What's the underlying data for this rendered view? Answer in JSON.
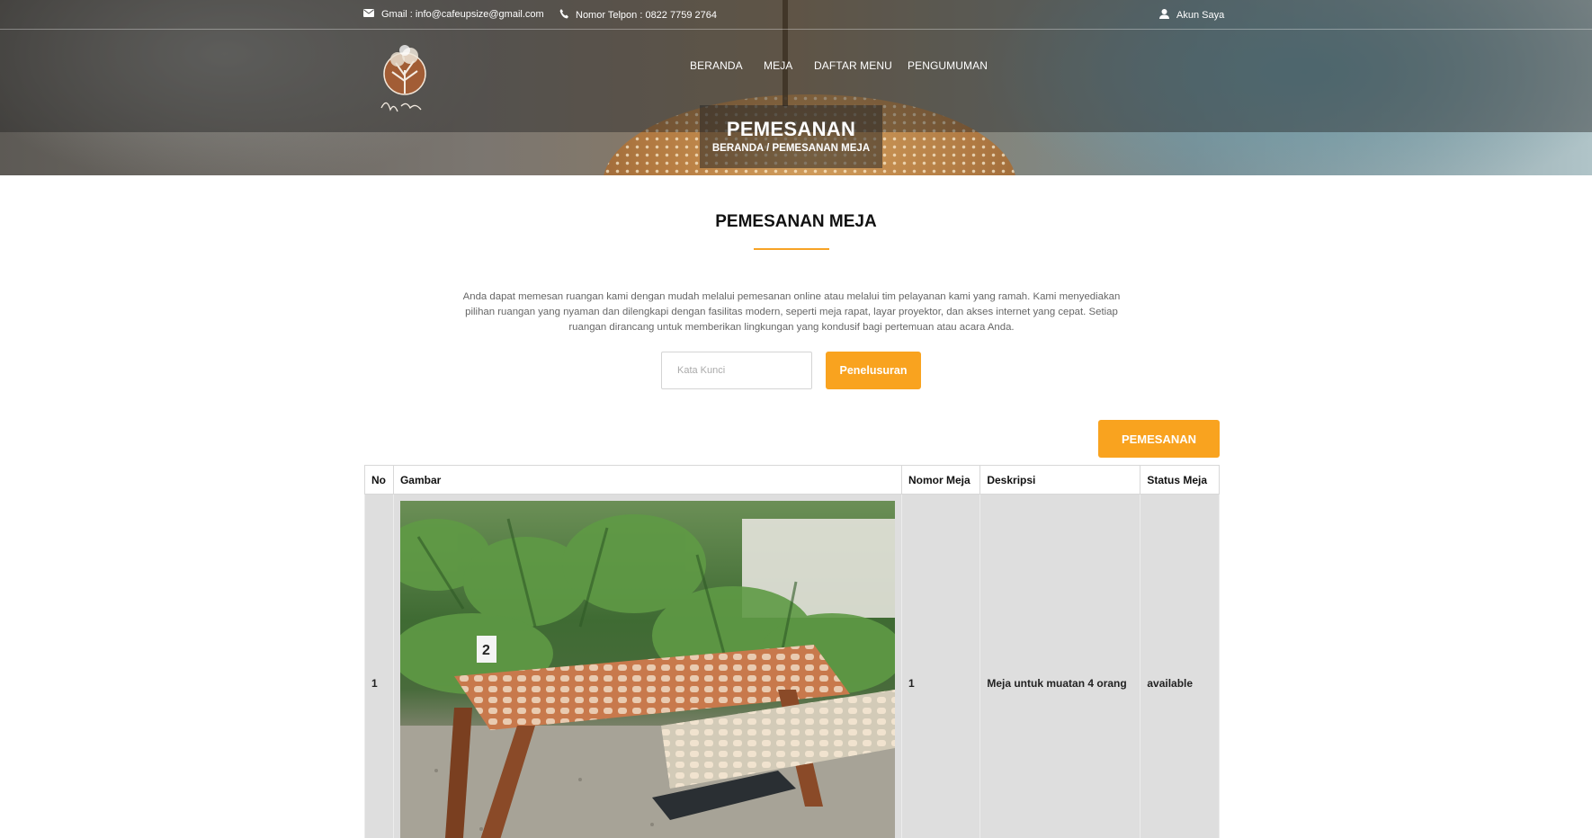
{
  "topbar": {
    "email": "Gmail : info@cafeupsize@gmail.com",
    "phone": "Nomor Telpon : 0822 7759 2764",
    "account": "Akun Saya"
  },
  "nav": {
    "items": [
      "BERANDA",
      "MEJA",
      "DAFTAR MENU",
      "PENGUMUMAN"
    ]
  },
  "banner": {
    "title": "PEMESANAN",
    "breadcrumb": "BERANDA  /  PEMESANAN MEJA"
  },
  "main": {
    "title": "PEMESANAN MEJA",
    "intro": "Anda dapat memesan ruangan kami dengan mudah melalui pemesanan online atau melalui tim pelayanan kami yang ramah. Kami menyediakan pilihan ruangan yang nyaman dan dilengkapi dengan fasilitas modern, seperti meja rapat, layar proyektor, dan akses internet yang cepat. Setiap ruangan dirancang untuk memberikan lingkungan yang kondusif bagi pertemuan atau acara Anda.",
    "search_placeholder": "Kata Kunci",
    "search_button": "Penelusuran",
    "order_button": "PEMESANAN"
  },
  "table": {
    "headers": [
      "No",
      "Gambar",
      "Nomor Meja",
      "Deskripsi",
      "Status Meja"
    ],
    "rows": [
      {
        "no": "1",
        "nomor_meja": "1",
        "deskripsi": "Meja untuk muatan 4 orang",
        "status": "available",
        "table_tag": "2"
      }
    ]
  },
  "colors": {
    "accent": "#f9a31f",
    "row_bg": "#dedede"
  },
  "icons": [
    "mail-icon",
    "phone-icon",
    "user-icon",
    "cafe-logo"
  ]
}
